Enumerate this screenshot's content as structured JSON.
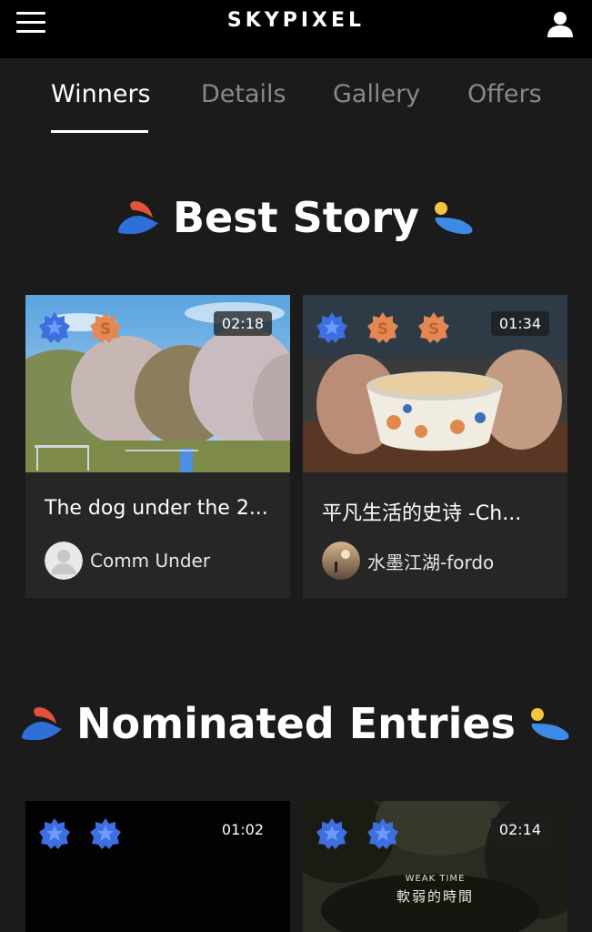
{
  "header": {
    "logo": "SKYPIXEL"
  },
  "tabs": [
    {
      "label": "Winners",
      "active": true
    },
    {
      "label": "Details",
      "active": false
    },
    {
      "label": "Gallery",
      "active": false
    },
    {
      "label": "Offers",
      "active": false
    }
  ],
  "sections": {
    "best_story": {
      "title": "Best Story",
      "cards": [
        {
          "title": "The dog under the 2...",
          "duration": "02:18",
          "author": "Comm Under",
          "badges": [
            "star-badge-blue",
            "s-badge-orange"
          ]
        },
        {
          "title": "平凡生活的史诗 -Ch...",
          "duration": "01:34",
          "author": "水墨江湖-fordo",
          "badges": [
            "star-badge-blue",
            "s-badge-orange",
            "s-badge-orange"
          ]
        }
      ]
    },
    "nominated": {
      "title": "Nominated Entries",
      "cards": [
        {
          "duration": "01:02",
          "badges": [
            "star-badge-blue",
            "star-badge-blue"
          ]
        },
        {
          "duration": "02:14",
          "badges": [
            "star-badge-blue",
            "star-badge-blue"
          ],
          "overlay_text": "WEAK TIME",
          "overlay_text_cn": "軟弱的時間"
        }
      ]
    }
  },
  "colors": {
    "background": "#1b1b1b",
    "topbar": "#000000",
    "card": "#262626",
    "tab_inactive": "#888888",
    "badge_blue": "#3d6fe0",
    "badge_orange": "#e38852",
    "accent_red": "#e2513a",
    "accent_blue": "#2f6fd8",
    "accent_yellow": "#f3c43c"
  }
}
